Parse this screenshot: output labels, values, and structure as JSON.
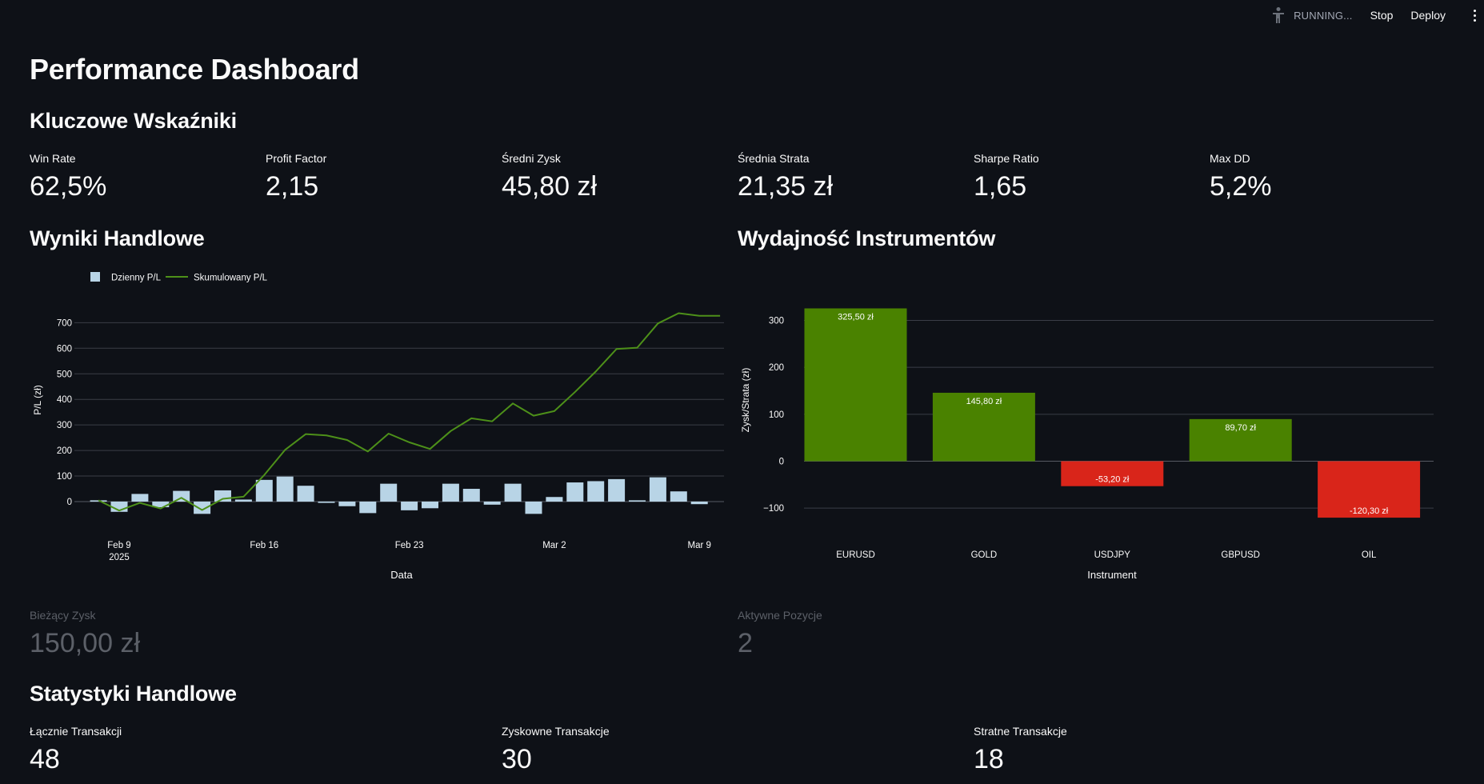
{
  "toolbar": {
    "running_label": "RUNNING...",
    "stop_label": "Stop",
    "deploy_label": "Deploy",
    "running_icon": "running-man-icon",
    "menu_icon": "kebab-menu-icon"
  },
  "page": {
    "title": "Performance Dashboard"
  },
  "key_metrics": {
    "heading": "Kluczowe Wskaźniki",
    "items": [
      {
        "label": "Win Rate",
        "value": "62,5%"
      },
      {
        "label": "Profit Factor",
        "value": "2,15"
      },
      {
        "label": "Średni Zysk",
        "value": "45,80 zł"
      },
      {
        "label": "Średnia Strata",
        "value": "21,35 zł"
      },
      {
        "label": "Sharpe Ratio",
        "value": "1,65"
      },
      {
        "label": "Max DD",
        "value": "5,2%"
      }
    ]
  },
  "trading_results": {
    "heading": "Wyniki Handlowe"
  },
  "instrument_perf": {
    "heading": "Wydajność Instrumentów"
  },
  "live": {
    "current_profit": {
      "label": "Bieżący Zysk",
      "value": "150,00 zł"
    },
    "active_positions": {
      "label": "Aktywne Pozycje",
      "value": "2"
    }
  },
  "trade_stats": {
    "heading": "Statystyki Handlowe",
    "items": [
      {
        "label": "Łącznie Transakcji",
        "value": "48"
      },
      {
        "label": "Zyskowne Transakcje",
        "value": "30"
      },
      {
        "label": "Stratne Transakcje",
        "value": "18"
      }
    ]
  },
  "colors": {
    "bg": "#0e1117",
    "bar_daily": "#b8d4e6",
    "line_cum": "#4d9019",
    "positive": "#4a8200",
    "negative": "#d9251a",
    "grid": "#3a3e47"
  },
  "chart_data": [
    {
      "type": "bar",
      "xlabel": "Data",
      "ylabel": "P/L (zł)",
      "ylim": [
        -50,
        720
      ],
      "yticks": [
        0,
        100,
        200,
        300,
        400,
        500,
        600,
        700
      ],
      "xtick_labels": [
        {
          "date": "2025-02-09",
          "label": "Feb 9",
          "sub": "2025"
        },
        {
          "date": "2025-02-16",
          "label": "Feb 16",
          "sub": ""
        },
        {
          "date": "2025-02-23",
          "label": "Feb 23",
          "sub": ""
        },
        {
          "date": "2025-03-02",
          "label": "Mar 2",
          "sub": ""
        },
        {
          "date": "2025-03-09",
          "label": "Mar 9",
          "sub": ""
        }
      ],
      "legend": {
        "placement": "top-left"
      },
      "dates": [
        "2025-02-08",
        "2025-02-09",
        "2025-02-10",
        "2025-02-11",
        "2025-02-12",
        "2025-02-13",
        "2025-02-14",
        "2025-02-15",
        "2025-02-16",
        "2025-02-17",
        "2025-02-18",
        "2025-02-19",
        "2025-02-20",
        "2025-02-21",
        "2025-02-22",
        "2025-02-23",
        "2025-02-24",
        "2025-02-25",
        "2025-02-26",
        "2025-02-27",
        "2025-02-28",
        "2025-03-01",
        "2025-03-02",
        "2025-03-03",
        "2025-03-04",
        "2025-03-05",
        "2025-03-06",
        "2025-03-07",
        "2025-03-08",
        "2025-03-09",
        "2025-03-10"
      ],
      "series": [
        {
          "name": "Dzienny P/L",
          "type": "bar",
          "values": [
            5,
            -40,
            30,
            -22,
            42,
            -48,
            44,
            8,
            85,
            98,
            62,
            -5,
            -18,
            -45,
            70,
            -34,
            -26,
            70,
            50,
            -12,
            70,
            -48,
            18,
            75,
            80,
            88,
            5,
            95,
            40,
            -10,
            0
          ]
        },
        {
          "name": "Skumulowany P/L",
          "type": "line",
          "values": [
            5,
            -35,
            -5,
            -27,
            15,
            -33,
            11,
            19,
            104,
            202,
            264,
            259,
            241,
            196,
            266,
            232,
            206,
            276,
            326,
            314,
            384,
            336,
            354,
            429,
            509,
            597,
            602,
            697,
            737,
            727,
            727
          ]
        }
      ]
    },
    {
      "type": "bar",
      "xlabel": "Instrument",
      "ylabel": "Zysk/Strata (zł)",
      "ylim": [
        -120.3,
        325.5
      ],
      "yticks": [
        -100,
        0,
        100,
        200,
        300
      ],
      "categories": [
        "EURUSD",
        "GOLD",
        "USDJPY",
        "GBPUSD",
        "OIL"
      ],
      "values": [
        325.5,
        145.8,
        -53.2,
        89.7,
        -120.3
      ],
      "labels": [
        "325,50 zł",
        "145,80 zł",
        "-53,20 zł",
        "89,70 zł",
        "-120,30 zł"
      ]
    }
  ]
}
